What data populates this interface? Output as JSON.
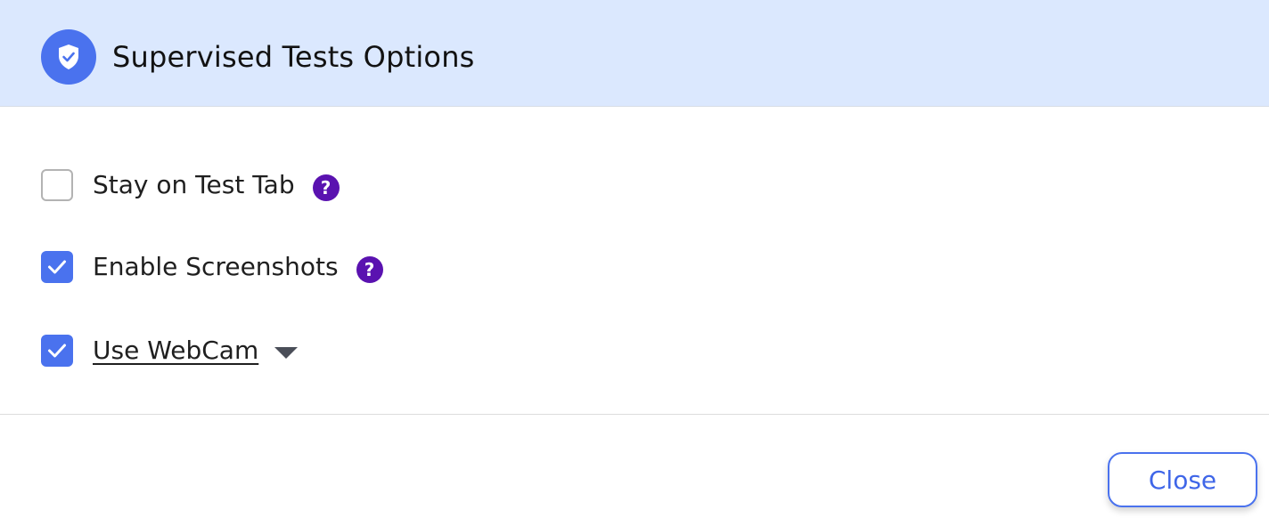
{
  "header": {
    "title": "Supervised Tests Options",
    "icon": "shield-check-icon"
  },
  "options": [
    {
      "label": "Stay on Test Tab",
      "checked": false,
      "help_icon": "question-icon",
      "help_text": "?"
    },
    {
      "label": "Enable Screenshots",
      "checked": true,
      "help_icon": "question-icon",
      "help_text": "?"
    },
    {
      "label": "Use WebCam",
      "checked": true,
      "expand_icon": "caret-down-icon"
    }
  ],
  "footer": {
    "close_label": "Close"
  },
  "colors": {
    "header_bg": "#dbe8fe",
    "accent": "#4a72ee",
    "help": "#5a12b0"
  }
}
